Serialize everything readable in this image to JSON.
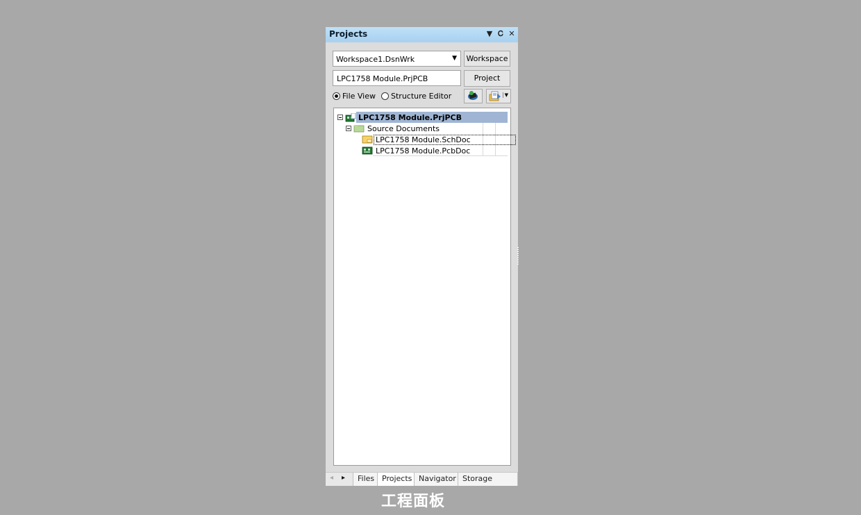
{
  "panel": {
    "title": "Projects",
    "title_icons": [
      "dropdown-arrow-icon",
      "pin-icon",
      "close-icon"
    ]
  },
  "workspace": {
    "combo_value": "Workspace1.DsnWrk",
    "button_label": "Workspace"
  },
  "project": {
    "field_value": "LPC1758 Module.PrjPCB",
    "button_label": "Project"
  },
  "view_mode": {
    "options": [
      {
        "label": "File View",
        "selected": true
      },
      {
        "label": "Structure Editor",
        "selected": false
      }
    ]
  },
  "tree": {
    "items": [
      {
        "label": "LPC1758 Module.PrjPCB",
        "icon": "pcb-project-icon",
        "level": 0,
        "expanded": true,
        "selected": true
      },
      {
        "label": "Source Documents",
        "icon": "folder-icon",
        "level": 1,
        "expanded": true
      },
      {
        "label": "LPC1758 Module.SchDoc",
        "icon": "schematic-doc-icon",
        "level": 2,
        "focused": true
      },
      {
        "label": "LPC1758 Module.PcbDoc",
        "icon": "pcb-doc-icon",
        "level": 2
      }
    ]
  },
  "tabs": {
    "items": [
      {
        "label": "Files",
        "active": false
      },
      {
        "label": "Projects",
        "active": true
      },
      {
        "label": "Navigator",
        "active": false
      },
      {
        "label": "Storage Manag",
        "active": false
      }
    ]
  },
  "caption": "工程面板"
}
